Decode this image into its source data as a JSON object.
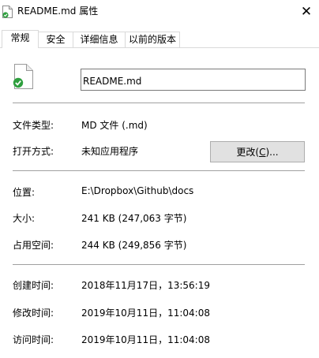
{
  "window": {
    "title": "README.md 属性",
    "close_glyph": "✕"
  },
  "tabs": [
    {
      "label": "常规",
      "active": true
    },
    {
      "label": "安全",
      "active": false
    },
    {
      "label": "详细信息",
      "active": false
    },
    {
      "label": "以前的版本",
      "active": false
    }
  ],
  "general": {
    "file_name": "README.md",
    "file_type_label": "文件类型:",
    "file_type_value": "MD 文件 (.md)",
    "open_with_label": "打开方式:",
    "open_with_value": "未知应用程序",
    "change_button": {
      "prefix": "更改(",
      "accel": "C",
      "suffix": ")..."
    },
    "location_label": "位置:",
    "location_value": "E:\\Dropbox\\Github\\docs",
    "size_label": "大小:",
    "size_value": "241 KB (247,063 字节)",
    "size_on_disk_label": "占用空间:",
    "size_on_disk_value": "244 KB (249,856 字节)",
    "created_label": "创建时间:",
    "created_value": "2018年11月17日，13:56:19",
    "modified_label": "修改时间:",
    "modified_value": "2019年10月11日，11:04:08",
    "accessed_label": "访问时间:",
    "accessed_value": "2019年10月11日，11:04:08"
  },
  "icons": {
    "title_icon": "file-synced-icon",
    "file_icon": "file-synced-icon",
    "sync_badge_color": "#2e9f3e"
  }
}
